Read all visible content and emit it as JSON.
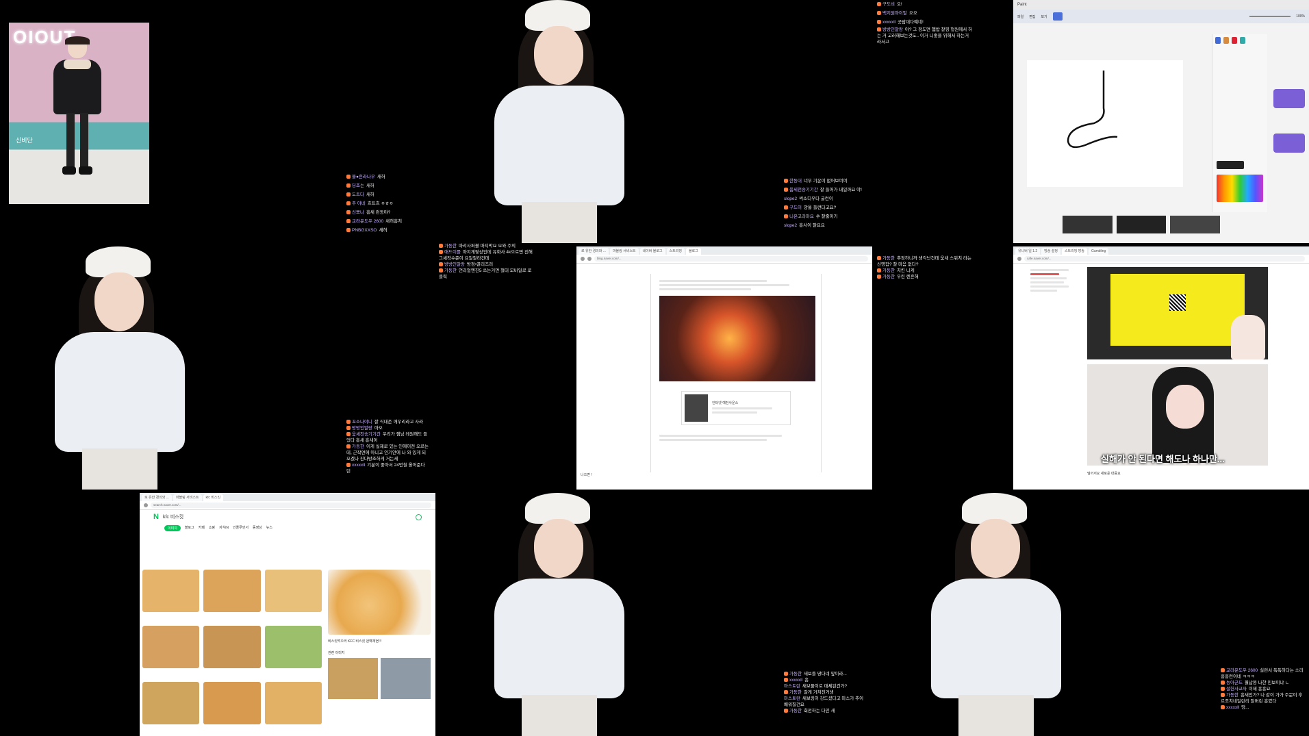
{
  "thumb": {
    "sign": "OIOUT",
    "caption": "신비단"
  },
  "chats": {
    "c1": [
      {
        "user": "불●흔라나우",
        "msg": "새허"
      },
      {
        "user": "딩조는",
        "msg": "새허"
      },
      {
        "user": "도트다",
        "msg": "새허"
      },
      {
        "user": "주 아네",
        "msg": "흐트흐 ㅇㅎㅇ"
      },
      {
        "user": "신뽀나",
        "msg": "흥새 런동야?"
      },
      {
        "user": "교라운도우 2600",
        "msg": "새허흥처"
      },
      {
        "user": "PNBGXXSO",
        "msg": "새허"
      }
    ],
    "c2": [
      {
        "user": "한동대",
        "msg": "너무 기운이 없어보여여"
      },
      {
        "user": "움세천송기기간",
        "msg": "잘 들어가 내일까요 야!"
      },
      {
        "user": "slope2",
        "msg": "썩소디우다 굴런이"
      },
      {
        "user": "구드이",
        "msg": "앙울 들런다고요?"
      },
      {
        "user": "니온고라마요",
        "msg": "수 잘줄이기"
      },
      {
        "user": "slope2",
        "msg": "흥사이 잘요요"
      }
    ],
    "c3": [
      {
        "user": "구도비",
        "msg": "오!"
      },
      {
        "user": "백지원마이말",
        "msg": "오오"
      },
      {
        "user": "xxxxxll",
        "msg": "굿밤대다예네!"
      },
      {
        "user": "방방인말랑",
        "msg": "아? 그 정도면 햄밥 잘핑 형원에서 하는 거 고러해보는것도.. 이거 니좋을 위해서 하는거라서고"
      }
    ],
    "c4": [
      {
        "user": "가동한",
        "msg": "마리사퍼볼 마지막요 오와 주의"
      },
      {
        "user": "애드이를",
        "msg": "마지게렇상인데 유화사 4k으로면 진해 그세작수준이 요알잘라건데"
      },
      {
        "user": "방방인말랑",
        "msg": "방정•끌리즈러"
      },
      {
        "user": "가동한",
        "msg": "언리얼엔진5 쓰는거면 절대 모바일로 로 클릭"
      }
    ],
    "c5": [
      {
        "user": "가동한",
        "msg": "추정하니까 생각난건데 움새 스위치 라는 신명잡? 잘 마음 없다?"
      },
      {
        "user": "가동한",
        "msg": "치킨 니케"
      },
      {
        "user": "가동한",
        "msg": "우린 렌흔해"
      }
    ],
    "c6": [
      {
        "user": "꼬소나야니",
        "msg": "잘 식대존 깨우리라고 사라"
      },
      {
        "user": "방방인말랑",
        "msg": "아오"
      },
      {
        "user": "움세천송기기간",
        "msg": "우리가 잼남 레원해도 들었다 흥새 흥새어"
      },
      {
        "user": "가동한",
        "msg": "이게 실제로 있는 인에이전 오르는데, 근작연에 아니고 인기안에 나 와 있게 되오겠나 진다방조하게 거는세"
      },
      {
        "user": "xxxxxll",
        "msg": "기분이 좋아서 24번칠 올어준다던"
      }
    ],
    "c7": [
      {
        "user": "가동한",
        "msg": "새보를 땅다네 앞이라..."
      },
      {
        "user": "xxxxxll",
        "msg": "흠"
      },
      {
        "user": "마스토란",
        "msg": "새보풀이로 대체된건가?"
      },
      {
        "user": "가동한",
        "msg": "갈게 거처진거생"
      },
      {
        "user": "마스토란",
        "msg": "새보링이 강드셨다고 마스가 추이 배워질건요"
      },
      {
        "user": "가동한",
        "msg": "회전하는 다인 새"
      }
    ],
    "c8": [
      {
        "user": "교라운도우 2600",
        "msg": "실런서 독독하다는 소리 흥흥런이네 ㅋㅋㅋ"
      },
      {
        "user": "능아군드",
        "msg": "월납봉 나한 민보이냐 ㄴ"
      },
      {
        "user": "설헌사교자",
        "msg": "이제 흥흥요"
      },
      {
        "user": "가동한",
        "msg": "흥새인가? 나 같이 가가 주문이 후르조치네일런리 잘버린 흥였다"
      },
      {
        "user": "xxxxxll",
        "msg": "땅..."
      }
    ]
  },
  "paint": {
    "title": "Paint",
    "tabs": [
      "파일",
      "편집",
      "보기"
    ],
    "zoom": "100%"
  },
  "blog": {
    "tabs": [
      "로 유한 경의와 ...",
      "마블링 서비스트",
      "네이버 블로그",
      "스트리밍",
      "블로그"
    ],
    "url": "blog.naver.com/...",
    "card_title": "인터넷 예전사운스",
    "footer": "나으면 !"
  },
  "vtuber": {
    "tabs": [
      "유니버 일 1.2",
      "방송 설정",
      "스트리밍 방송",
      "Gambling"
    ],
    "url": "cafe.naver.com/...",
    "subtitle": "실해가 안 된다면 해도나 하나만...",
    "caption": "덤어서요 새로운 대응요"
  },
  "search": {
    "logo": "N",
    "query": "kfc 비스킷",
    "tabs": [
      "이미지",
      "블로그",
      "카페",
      "쇼핑",
      "지식iN",
      "인플루언서",
      "동영상",
      "뉴스"
    ],
    "url": "search.naver.com/...",
    "preview_title": "비스킷먹으러 KFC 비스킷 완벽재현!!!",
    "related": "관련 이미지"
  }
}
